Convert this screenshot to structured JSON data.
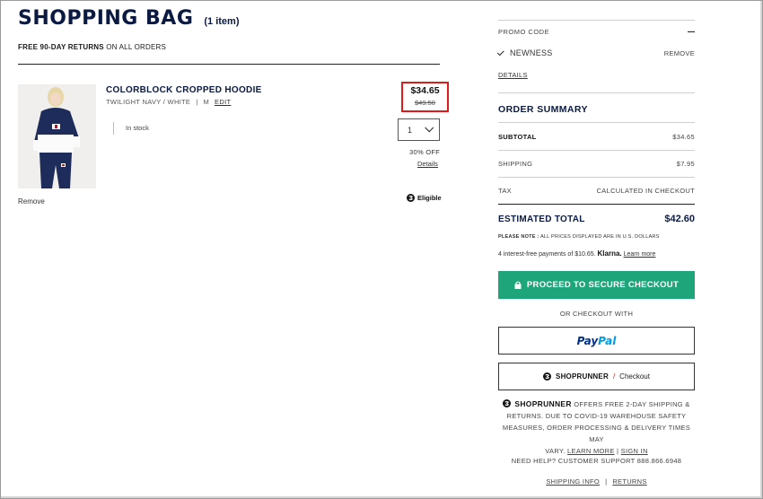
{
  "bag": {
    "title": "SHOPPING BAG",
    "count": "(1 item)",
    "returns_bold": "FREE 90-DAY RETURNS",
    "returns_rest": " ON ALL ORDERS"
  },
  "product": {
    "name": "COLORBLOCK CROPPED HOODIE",
    "color": "TWILIGHT NAVY / WHITE",
    "sep": "|",
    "size": "M",
    "edit_label": "EDIT",
    "stock": "In stock",
    "price_now": "$34.65",
    "price_was": "$49.50",
    "qty": "1",
    "discount": "30% OFF",
    "details_label": "Details",
    "eligible": "Eligible",
    "remove_label": "Remove",
    "image_icon": "hoodie-product-photo"
  },
  "promo": {
    "header": "PROMO CODE",
    "code": "NEWNESS",
    "remove_label": "REMOVE",
    "details_label": "DETAILS"
  },
  "summary": {
    "title": "ORDER SUMMARY",
    "subtotal_label": "SUBTOTAL",
    "subtotal_value": "$34.65",
    "shipping_label": "SHIPPING",
    "shipping_value": "$7.95",
    "tax_label": "TAX",
    "tax_value": "CALCULATED IN CHECKOUT",
    "total_label": "ESTIMATED TOTAL",
    "total_value": "$42.60",
    "note_bold": "PLEASE NOTE :",
    "note_rest": " ALL PRICES DISPLAYED ARE IN U.S. DOLLARS",
    "klarna_pre": "4 interest-free payments of $10.65.",
    "klarna_brand": "Klarna.",
    "klarna_link": "Learn more"
  },
  "checkout": {
    "button_label": "PROCEED TO SECURE CHECKOUT",
    "or_with": "OR CHECKOUT WITH",
    "paypal_1": "Pay",
    "paypal_2": "Pal",
    "shoprunner_label": "SHOPRUNNER",
    "shoprunner_slash": "/",
    "shoprunner_checkout": "Checkout"
  },
  "shoprunner_info": {
    "brand": "SHOPRUNNER",
    "text_1": " OFFERS FREE 2-DAY SHIPPING &",
    "text_2": "RETURNS. DUE TO COVID-19 WAREHOUSE SAFETY",
    "text_3": "MEASURES, ORDER PROCESSING & DELIVERY TIMES MAY",
    "text_4": "VARY.",
    "learn_more": "LEARN MORE",
    "sep": "|",
    "sign_in": "SIGN IN"
  },
  "footer": {
    "help": "NEED HELP? CUSTOMER SUPPORT 888.866.6948",
    "shipping_info": "SHIPPING INFO",
    "sep": "|",
    "returns": "RETURNS"
  },
  "colors": {
    "navy": "#0b1a42",
    "checkout_green": "#1fa57a",
    "highlight_red": "#e01919"
  }
}
